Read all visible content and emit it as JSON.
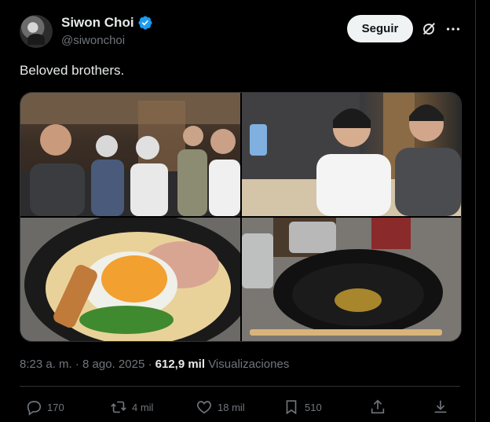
{
  "author": {
    "name": "Siwon Choi",
    "handle": "@siwonchoi",
    "verified": true
  },
  "header": {
    "follow_label": "Seguir"
  },
  "tweet": {
    "text": "Beloved brothers."
  },
  "meta": {
    "time": "8:23 a. m.",
    "separator": " · ",
    "date": "8 ago. 2025",
    "views_count": "612,9 mil",
    "views_label": "Visualizaciones"
  },
  "actions": {
    "replies": "170",
    "reposts": "4 mil",
    "likes": "18 mil",
    "bookmarks": "510"
  },
  "colors": {
    "background": "#000000",
    "text": "#e7e9ea",
    "muted": "#71767b",
    "verified": "#1d9bf0",
    "border": "#2f3336"
  }
}
